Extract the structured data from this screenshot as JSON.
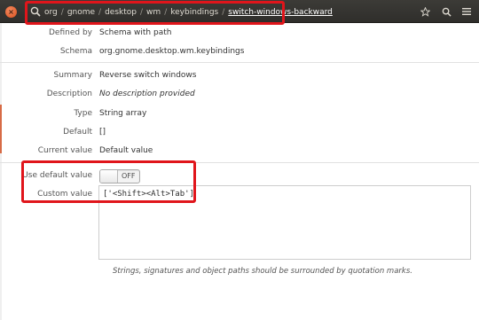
{
  "titlebar": {
    "close_glyph": "×",
    "breadcrumb": [
      "org",
      "gnome",
      "desktop",
      "wm",
      "keybindings",
      "switch-windows-backward"
    ],
    "separator": "/",
    "icons": [
      "dconf-app-icon",
      "star-icon",
      "search-icon",
      "hamburger-menu-icon"
    ]
  },
  "rows": {
    "defined_by": {
      "label": "Defined by",
      "value": "Schema with path"
    },
    "schema": {
      "label": "Schema",
      "value": "org.gnome.desktop.wm.keybindings"
    },
    "summary": {
      "label": "Summary",
      "value": "Reverse switch windows"
    },
    "description": {
      "label": "Description",
      "value": "No description provided"
    },
    "type": {
      "label": "Type",
      "value": "String array"
    },
    "default": {
      "label": "Default",
      "value": "[]"
    },
    "current_value": {
      "label": "Current value",
      "value": "Default value"
    },
    "use_default": {
      "label": "Use default value",
      "toggle_state": "OFF"
    },
    "custom_value": {
      "label": "Custom value",
      "value": "['<Shift><Alt>Tab']"
    }
  },
  "hint": "Strings, signatures and object paths should be surrounded by quotation marks.",
  "colors": {
    "titlebar": "#3c3b37",
    "highlight": "#e0151b",
    "close_button": "#d9501f"
  }
}
